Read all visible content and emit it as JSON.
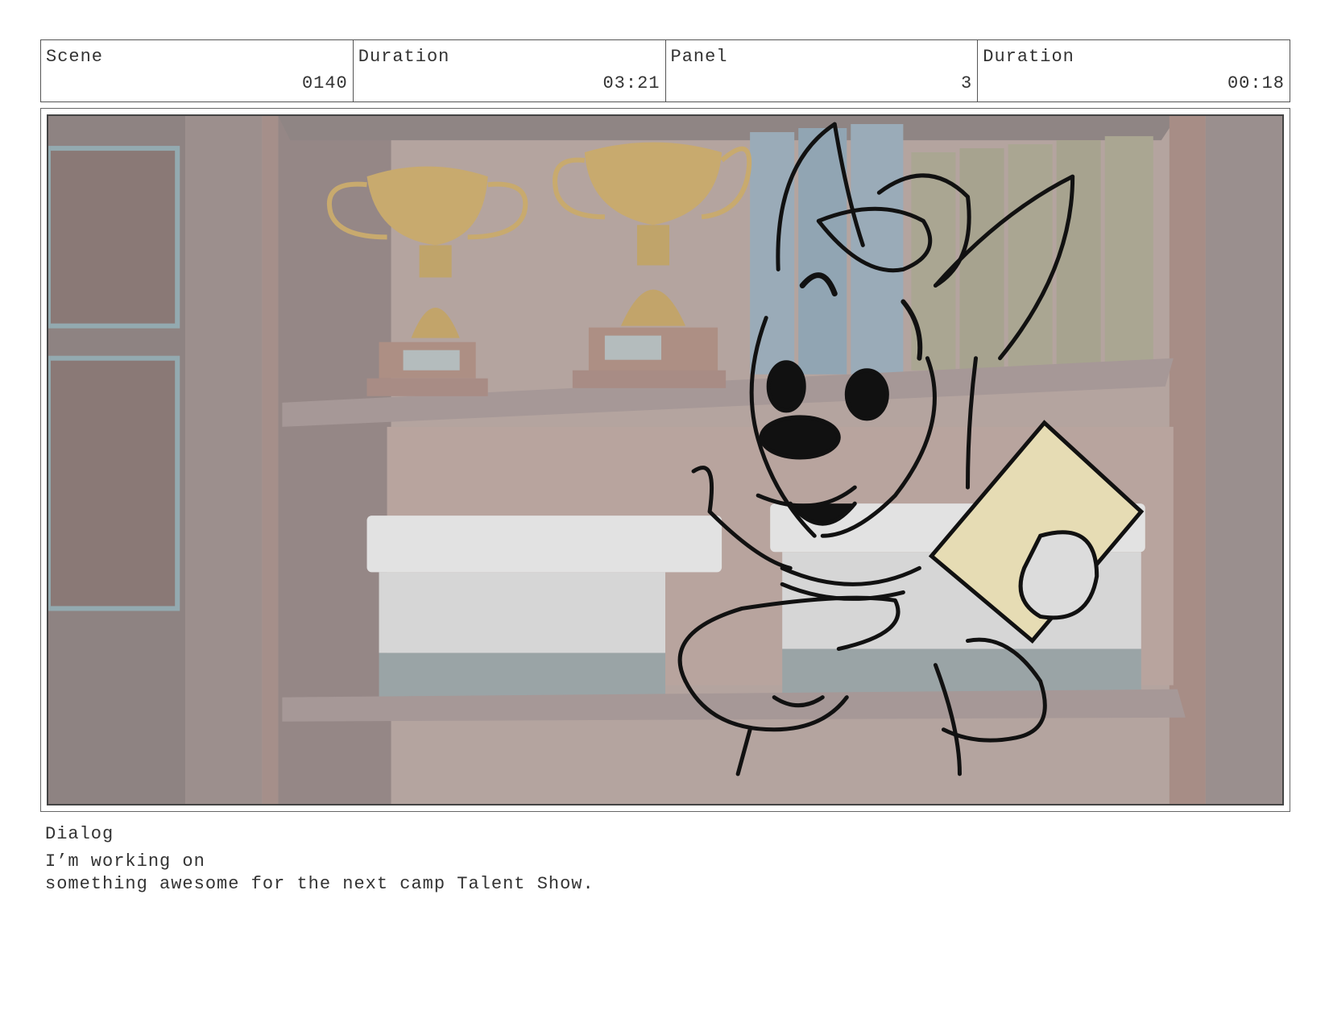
{
  "header": {
    "scene_label": "Scene",
    "scene_value": "0140",
    "scene_duration_label": "Duration",
    "scene_duration_value": "03:21",
    "panel_label": "Panel",
    "panel_value": "3",
    "panel_duration_label": "Duration",
    "panel_duration_value": "00:18"
  },
  "dialog": {
    "label": "Dialog",
    "line1": "I’m working on",
    "line2": "something awesome for the next camp Talent Show."
  },
  "colors": {
    "shelf": "#a99c99",
    "wall": "#b8a7a2",
    "trophy": "#c8aa6e",
    "box_top": "#e2e2e2",
    "box_bottom": "#9aa4a6",
    "book_blue": "#9aabb8",
    "book_green": "#aaa692",
    "sketch": "#111111",
    "book_cover": "#e6dcb4"
  }
}
